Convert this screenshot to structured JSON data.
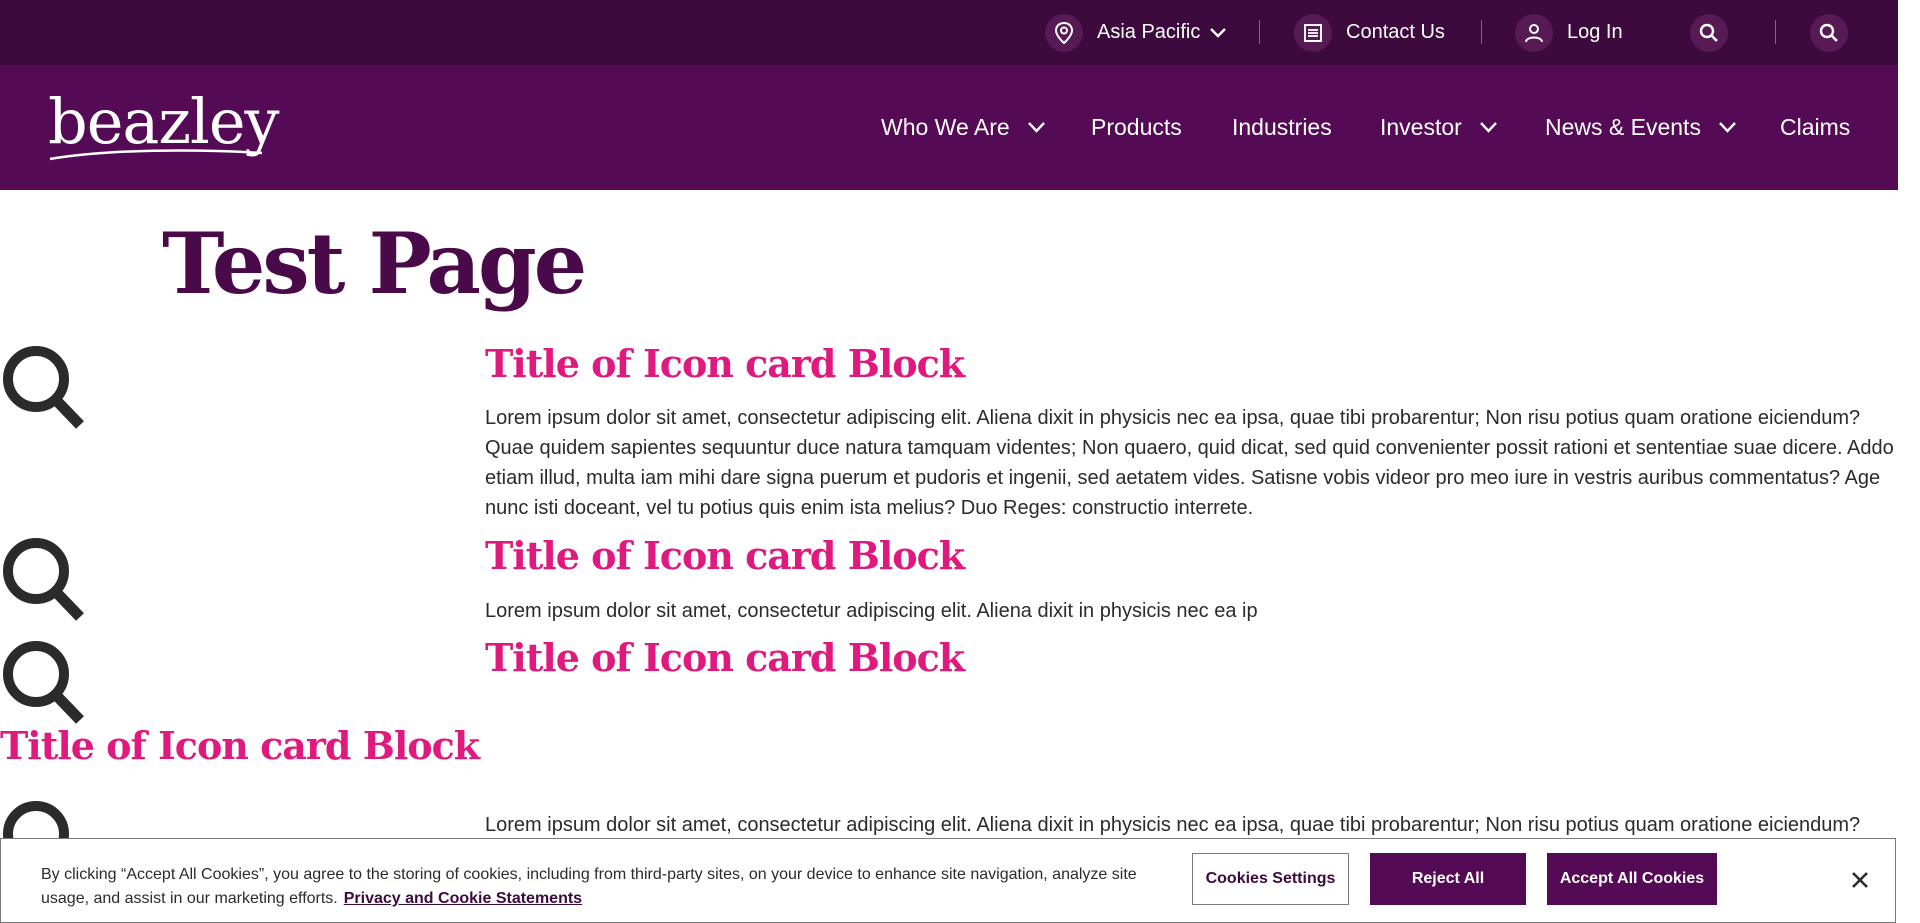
{
  "header": {
    "region_label": "Asia Pacific",
    "contact_label": "Contact Us",
    "login_label": "Log In",
    "separator": "|",
    "logo_text": "beazley"
  },
  "nav": {
    "items": [
      {
        "label": "Who We Are",
        "has_dropdown": true
      },
      {
        "label": "Products",
        "has_dropdown": false
      },
      {
        "label": "Industries",
        "has_dropdown": false
      },
      {
        "label": "Investor",
        "has_dropdown": true
      },
      {
        "label": "News & Events",
        "has_dropdown": true
      },
      {
        "label": "Claims",
        "has_dropdown": false
      }
    ]
  },
  "page": {
    "title": "Test Page",
    "cards": [
      {
        "title": "Title of Icon card Block",
        "text": "Lorem ipsum dolor sit amet, consectetur adipiscing elit. Aliena dixit in physicis nec ea ipsa, quae tibi probarentur; Non risu potius quam oratione eiciendum? Quae quidem sapientes sequuntur duce natura tamquam videntes; Non quaero, quid dicat, sed quid convenienter possit rationi et sententiae suae dicere. Addo etiam illud, multa iam mihi dare signa puerum et pudoris et ingenii, sed aetatem vides. Satisne vobis videor pro meo iure in vestris auribus commentatus? Age nunc isti doceant, vel tu potius quis enim ista melius? Duo Reges: constructio interrete.",
        "icon": "search-icon"
      },
      {
        "title": "Title of Icon card Block",
        "text": "Lorem ipsum dolor sit amet, consectetur adipiscing elit. Aliena dixit in physicis nec ea ip",
        "icon": "search-icon"
      },
      {
        "title": "Title of Icon card Block",
        "text": "",
        "icon": "search-icon"
      },
      {
        "title": "Title of Icon card Block",
        "text": "Lorem ipsum dolor sit amet, consectetur adipiscing elit. Aliena dixit in physicis nec ea ipsa, quae tibi probarentur; Non risu potius quam oratione eiciendum?",
        "icon": "search-icon"
      }
    ]
  },
  "cookie_banner": {
    "text": "By clicking “Accept All Cookies”, you agree to the storing of cookies, including from third-party sites, on your device to enhance site navigation, analyze site usage, and assist in our marketing efforts.",
    "link_label": "Privacy and Cookie Statements",
    "settings_label": "Cookies Settings",
    "reject_label": "Reject All",
    "accept_label": "Accept All Cookies"
  },
  "colors": {
    "utility_bar": "#3c0a3c",
    "nav_bar": "#550a55",
    "title": "#4a0a4a",
    "card_title": "#e0197f",
    "button": "#550a55"
  }
}
